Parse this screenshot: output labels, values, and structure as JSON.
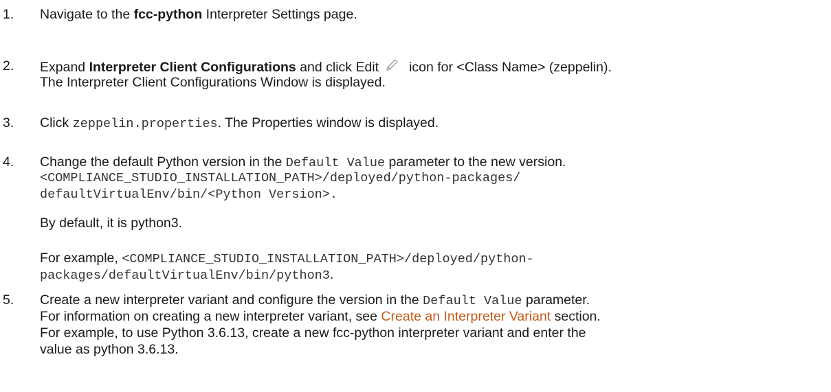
{
  "steps": [
    {
      "number": "1.",
      "pre": "Navigate to the ",
      "bold": "fcc-python",
      "post": " Interpreter Settings page."
    },
    {
      "number": "2.",
      "pre": "Expand ",
      "bold": "Interpreter Client Configurations",
      "mid": " and click Edit",
      "icon": "pencil-icon",
      "post": "icon for <Class Name> (zeppelin).",
      "line2": "The Interpreter Client Configurations Window is displayed."
    },
    {
      "number": "3.",
      "pre": "Click ",
      "code": "zeppelin.properties",
      "post": ". The Properties window is displayed."
    },
    {
      "number": "4.",
      "pre": "Change the default Python version in the ",
      "code": "Default Value",
      "post": " parameter to the new version.",
      "path_line1": "<COMPLIANCE_STUDIO_INSTALLATION_PATH>/deployed/python-packages/",
      "path_line2": "defaultVirtualEnv/bin/<Python Version>.",
      "default_note": "By default, it is python3.",
      "example_pre": "For example, ",
      "example_code1": "<COMPLIANCE_STUDIO_INSTALLATION_PATH>/deployed/python-",
      "example_code2": "packages/defaultVirtualEnv/bin/python3",
      "example_post": "."
    },
    {
      "number": "5.",
      "pre": "Create a new interpreter variant and configure the version in the ",
      "code": "Default Value",
      "post": " parameter.",
      "line2_pre": "For information on creating a new interpreter variant, see ",
      "line2_link": "Create an Interpreter Variant",
      "line2_post": " section.",
      "line3": "For example, to use Python 3.6.13, create a new fcc-python interpreter variant and enter the",
      "line4": "value as python 3.6.13."
    }
  ],
  "colors": {
    "text": "#1a1a1a",
    "code": "#333333",
    "link": "#c45a1b",
    "icon": "#9a9a9a"
  }
}
